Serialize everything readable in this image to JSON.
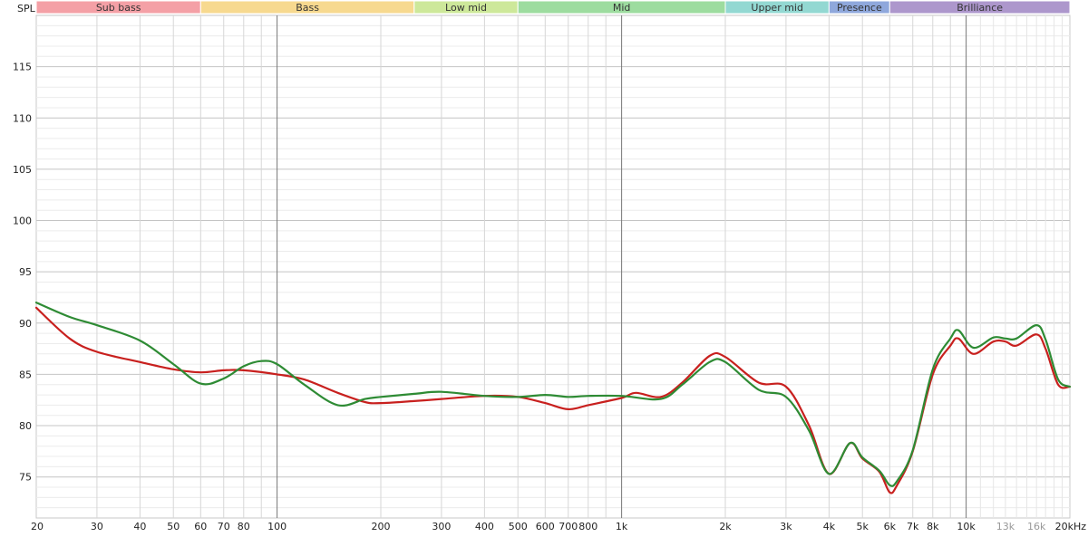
{
  "chart_data": {
    "type": "line",
    "y_axis_label": "SPL",
    "x_scale": "log",
    "xlim": [
      20,
      20000
    ],
    "ylim": [
      71,
      120
    ],
    "grid": true,
    "y_ticks": [
      75,
      80,
      85,
      90,
      95,
      100,
      105,
      110,
      115
    ],
    "x_ticks": [
      {
        "value": 20,
        "label": "20"
      },
      {
        "value": 30,
        "label": "30"
      },
      {
        "value": 40,
        "label": "40"
      },
      {
        "value": 50,
        "label": "50"
      },
      {
        "value": 60,
        "label": "60"
      },
      {
        "value": 70,
        "label": "70"
      },
      {
        "value": 80,
        "label": "80"
      },
      {
        "value": 100,
        "label": "100"
      },
      {
        "value": 200,
        "label": "200"
      },
      {
        "value": 300,
        "label": "300"
      },
      {
        "value": 400,
        "label": "400"
      },
      {
        "value": 500,
        "label": "500"
      },
      {
        "value": 600,
        "label": "600"
      },
      {
        "value": 700,
        "label": "700"
      },
      {
        "value": 800,
        "label": "800"
      },
      {
        "value": 1000,
        "label": "1k"
      },
      {
        "value": 2000,
        "label": "2k"
      },
      {
        "value": 3000,
        "label": "3k"
      },
      {
        "value": 4000,
        "label": "4k"
      },
      {
        "value": 5000,
        "label": "5k"
      },
      {
        "value": 6000,
        "label": "6k"
      },
      {
        "value": 7000,
        "label": "7k"
      },
      {
        "value": 8000,
        "label": "8k"
      },
      {
        "value": 10000,
        "label": "10k"
      },
      {
        "value": 13000,
        "label": "13k",
        "dim": true
      },
      {
        "value": 16000,
        "label": "16k",
        "dim": true
      },
      {
        "value": 20000,
        "label": "20kHz"
      }
    ],
    "bands": [
      {
        "name": "Sub bass",
        "from": 20,
        "to": 60,
        "color": "#f4a0a6"
      },
      {
        "name": "Bass",
        "from": 60,
        "to": 250,
        "color": "#f7d98f"
      },
      {
        "name": "Low mid",
        "from": 250,
        "to": 500,
        "color": "#cde89a"
      },
      {
        "name": "Mid",
        "from": 500,
        "to": 2000,
        "color": "#9ddc9f"
      },
      {
        "name": "Upper mid",
        "from": 2000,
        "to": 4000,
        "color": "#93d8d2"
      },
      {
        "name": "Presence",
        "from": 4000,
        "to": 6000,
        "color": "#8fa8dc"
      },
      {
        "name": "Brilliance",
        "from": 6000,
        "to": 20000,
        "color": "#ad97cc"
      }
    ],
    "series": [
      {
        "color": "#c8201e",
        "points": [
          [
            20,
            91.5
          ],
          [
            25,
            88.5
          ],
          [
            30,
            87.2
          ],
          [
            40,
            86.2
          ],
          [
            50,
            85.5
          ],
          [
            60,
            85.2
          ],
          [
            70,
            85.4
          ],
          [
            80,
            85.4
          ],
          [
            100,
            85.0
          ],
          [
            120,
            84.5
          ],
          [
            150,
            83.2
          ],
          [
            180,
            82.3
          ],
          [
            200,
            82.2
          ],
          [
            250,
            82.4
          ],
          [
            300,
            82.6
          ],
          [
            400,
            82.9
          ],
          [
            500,
            82.8
          ],
          [
            600,
            82.2
          ],
          [
            700,
            81.6
          ],
          [
            800,
            82.0
          ],
          [
            1000,
            82.7
          ],
          [
            1100,
            83.2
          ],
          [
            1300,
            82.8
          ],
          [
            1500,
            84.2
          ],
          [
            1800,
            86.8
          ],
          [
            2000,
            86.7
          ],
          [
            2500,
            84.2
          ],
          [
            3000,
            83.8
          ],
          [
            3500,
            80.0
          ],
          [
            4000,
            75.3
          ],
          [
            4600,
            78.3
          ],
          [
            5000,
            76.8
          ],
          [
            5600,
            75.5
          ],
          [
            6000,
            73.5
          ],
          [
            6300,
            74.2
          ],
          [
            7000,
            77.5
          ],
          [
            8000,
            85.0
          ],
          [
            9000,
            87.8
          ],
          [
            9500,
            88.5
          ],
          [
            10500,
            87.0
          ],
          [
            12000,
            88.2
          ],
          [
            13000,
            88.2
          ],
          [
            14000,
            87.8
          ],
          [
            16000,
            88.9
          ],
          [
            17000,
            87.5
          ],
          [
            18500,
            84.0
          ],
          [
            20000,
            83.8
          ]
        ]
      },
      {
        "color": "#2e8b34",
        "points": [
          [
            20,
            92.0
          ],
          [
            25,
            90.6
          ],
          [
            30,
            89.8
          ],
          [
            40,
            88.3
          ],
          [
            50,
            86.0
          ],
          [
            60,
            84.1
          ],
          [
            70,
            84.6
          ],
          [
            80,
            85.8
          ],
          [
            90,
            86.3
          ],
          [
            100,
            86.0
          ],
          [
            120,
            84.0
          ],
          [
            150,
            82.0
          ],
          [
            180,
            82.6
          ],
          [
            200,
            82.8
          ],
          [
            250,
            83.1
          ],
          [
            300,
            83.3
          ],
          [
            400,
            82.9
          ],
          [
            500,
            82.8
          ],
          [
            600,
            83.0
          ],
          [
            700,
            82.8
          ],
          [
            800,
            82.9
          ],
          [
            1000,
            82.9
          ],
          [
            1300,
            82.6
          ],
          [
            1500,
            84.0
          ],
          [
            1800,
            86.2
          ],
          [
            2000,
            86.2
          ],
          [
            2500,
            83.5
          ],
          [
            3000,
            82.8
          ],
          [
            3500,
            79.5
          ],
          [
            4000,
            75.3
          ],
          [
            4600,
            78.3
          ],
          [
            5000,
            76.9
          ],
          [
            5600,
            75.6
          ],
          [
            6000,
            74.2
          ],
          [
            6300,
            74.6
          ],
          [
            7000,
            77.6
          ],
          [
            8000,
            85.5
          ],
          [
            9000,
            88.5
          ],
          [
            9500,
            89.3
          ],
          [
            10500,
            87.6
          ],
          [
            12000,
            88.6
          ],
          [
            13000,
            88.5
          ],
          [
            14000,
            88.5
          ],
          [
            16000,
            89.8
          ],
          [
            17000,
            88.4
          ],
          [
            18500,
            84.5
          ],
          [
            20000,
            83.8
          ]
        ]
      }
    ]
  }
}
